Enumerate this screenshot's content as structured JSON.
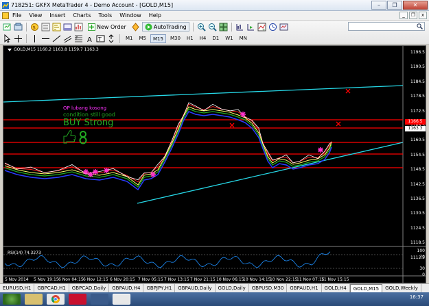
{
  "window": {
    "title": "718251: GKFX MetaTrader 4 - Demo Account - [GOLD,M15]",
    "buttons": [
      "–",
      "❐",
      "✕"
    ]
  },
  "menu": {
    "items": [
      "File",
      "View",
      "Insert",
      "Charts",
      "Tools",
      "Window",
      "Help"
    ],
    "mdi_buttons": [
      "_",
      "❐",
      "x"
    ]
  },
  "toolbar": {
    "new_order": "New Order",
    "autotrading": "AutoTrading",
    "timeframes": [
      "M1",
      "M5",
      "M15",
      "M30",
      "H1",
      "H4",
      "D1",
      "W1",
      "MN"
    ],
    "active_timeframe": "M15",
    "search_placeholder": ""
  },
  "chart": {
    "header": "GOLD,M15  1160.2 1163.8 1159.7 1163.3",
    "price_axis": [
      "1196.5",
      "1190.5",
      "1184.5",
      "1178.5",
      "1172.5",
      "1166.5",
      "1160.5",
      "1154.5",
      "1148.5",
      "1142.5",
      "1136.5",
      "1130.5",
      "1124.5",
      "1118.5",
      "1112.5"
    ],
    "current_price": "1163.3",
    "line_price": "1166.5",
    "annotations": {
      "line1": "OP lubang kosong",
      "line2": "condition still good",
      "line3": "BUY Strong"
    },
    "colors": {
      "background": "#000000",
      "trendline": "#26d7e6",
      "resistance": "#ff0000",
      "price": "#ffffff",
      "ma_fast": "#ff2222",
      "ma_mid": "#ffff66",
      "ma_slow": "#2a3cff",
      "ma_long": "#22aa22",
      "signal": "#ff33cc"
    }
  },
  "rsi": {
    "label": "RSI(14) 74.3273",
    "levels": [
      "100",
      "70",
      "30",
      "0"
    ]
  },
  "time_axis": [
    "5 Nov 2014",
    "5 Nov 19:15",
    "6 Nov 04:15",
    "6 Nov 12:15",
    "6 Nov 20:15",
    "7 Nov 05:15",
    "7 Nov 13:15",
    "7 Nov 21:15",
    "10 Nov 06:15",
    "10 Nov 14:15",
    "10 Nov 22:15",
    "11 Nov 07:15",
    "11 Nov 15:15"
  ],
  "tabs": [
    "EURUSD,H1",
    "GBPCAD,H1",
    "GBPCAD,Daily",
    "GBPAUD,H4",
    "GBPJPY,H1",
    "GBPAUD,Daily",
    "GOLD,Daily",
    "GBPUSD,M30",
    "GBPAUD,H1",
    "GOLD,H4",
    "GOLD,M15",
    "GOLD,Weekly"
  ],
  "active_tab": "GOLD,M15",
  "taskbar": {
    "clock": "16:37"
  }
}
